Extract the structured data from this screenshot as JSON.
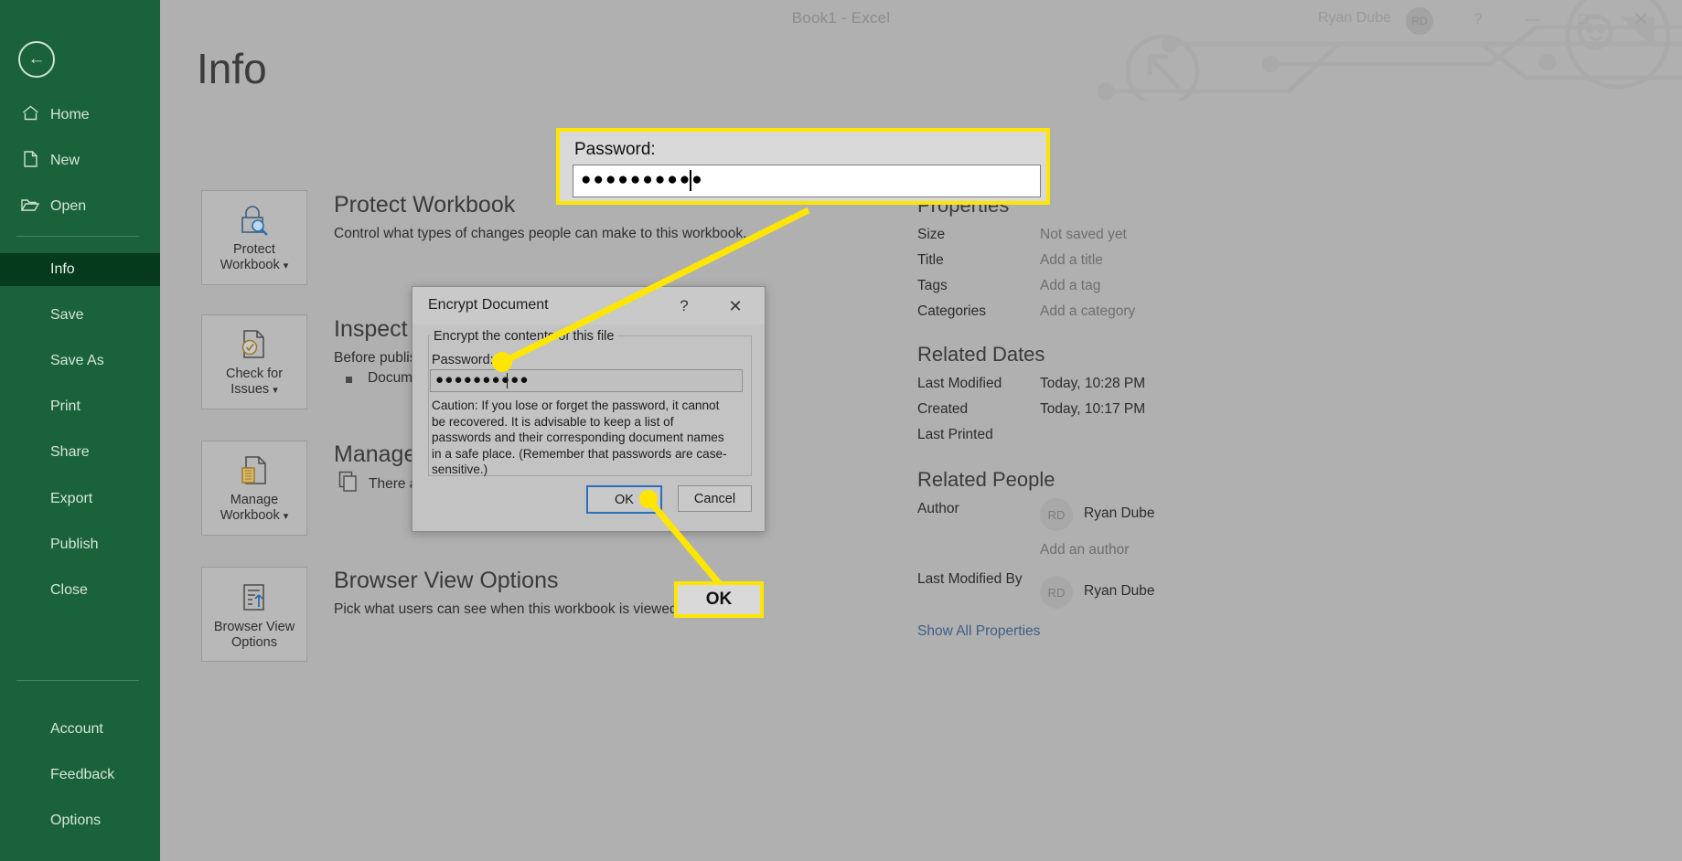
{
  "window": {
    "title": "Book1  -  Excel",
    "user_name": "Ryan Dube",
    "user_initials": "RD",
    "help_icon": "?",
    "minimize_icon": "—",
    "maximize_icon": "□",
    "close_icon": "✕"
  },
  "nav": {
    "back_icon": "←",
    "items": [
      {
        "label": "Home",
        "icon": "⌂"
      },
      {
        "label": "New",
        "icon": "὜B"
      },
      {
        "label": "Open",
        "icon": "▱"
      },
      {
        "label": "Info",
        "icon": ""
      },
      {
        "label": "Save",
        "icon": ""
      },
      {
        "label": "Save As",
        "icon": ""
      },
      {
        "label": "Print",
        "icon": ""
      },
      {
        "label": "Share",
        "icon": ""
      },
      {
        "label": "Export",
        "icon": ""
      },
      {
        "label": "Publish",
        "icon": ""
      },
      {
        "label": "Close",
        "icon": ""
      },
      {
        "label": "Account",
        "icon": ""
      },
      {
        "label": "Feedback",
        "icon": ""
      },
      {
        "label": "Options",
        "icon": ""
      }
    ],
    "selected": "Info"
  },
  "page": {
    "title": "Info"
  },
  "sections": [
    {
      "card_label": "Protect\nWorkbook ▾",
      "card_icon": "lock-magnifier-icon",
      "heading": "Protect Workbook",
      "description": "Control what types of changes people can make to this workbook."
    },
    {
      "card_label": "Check for\nIssues ▾",
      "card_icon": "document-check-icon",
      "heading": "Inspect Workbook",
      "description": "Before publishing this file, be aware that it contains:",
      "bullet": "Document properties and author's name"
    },
    {
      "card_label": "Manage\nWorkbook ▾",
      "card_icon": "document-recycle-icon",
      "heading": "Manage Workbook",
      "description": "There are no unsaved changes."
    },
    {
      "card_label": "Browser View\nOptions",
      "card_icon": "document-arrow-up-icon",
      "heading": "Browser View Options",
      "description": "Pick what users can see when this workbook is viewed on the Web."
    }
  ],
  "properties": {
    "heading": "Properties",
    "rows": [
      {
        "key": "Size",
        "value": "Not saved yet"
      },
      {
        "key": "Title",
        "value": "Add a title"
      },
      {
        "key": "Tags",
        "value": "Add a tag"
      },
      {
        "key": "Categories",
        "value": "Add a category"
      }
    ]
  },
  "related_dates": {
    "heading": "Related Dates",
    "rows": [
      {
        "key": "Last Modified",
        "value": "Today, 10:28 PM"
      },
      {
        "key": "Created",
        "value": "Today, 10:17 PM"
      },
      {
        "key": "Last Printed",
        "value": ""
      }
    ]
  },
  "related_people": {
    "heading": "Related People",
    "author_key": "Author",
    "author_initials": "RD",
    "author_name": "Ryan Dube",
    "add_author": "Add an author",
    "modified_key": "Last Modified By",
    "modified_initials": "RD",
    "modified_name": "Ryan Dube"
  },
  "show_all_properties": "Show All Properties",
  "dialog": {
    "title": "Encrypt Document",
    "help_icon": "?",
    "close_icon": "✕",
    "group_label": "Encrypt the contents of this file",
    "password_label": "Password:",
    "password_value": "●●●●●●●●●●",
    "caution": "Caution: If you lose or forget the password, it cannot be recovered. It is advisable to keep a list of passwords and their corresponding document names in a safe place. (Remember that passwords are case-sensitive.)",
    "ok_label": "OK",
    "cancel_label": "Cancel"
  },
  "callouts": {
    "password": {
      "label": "Password:",
      "value": "●●●●●●●●●●"
    },
    "ok": {
      "label": "OK"
    }
  },
  "colors": {
    "nav_green": "#1a6239",
    "nav_selected_green": "#063a1c",
    "highlight_yellow": "#ffe600",
    "link_blue": "#3f5f86",
    "dialog_gray": "#c3c3c3",
    "overlay_gray": "#b0b0b0"
  }
}
